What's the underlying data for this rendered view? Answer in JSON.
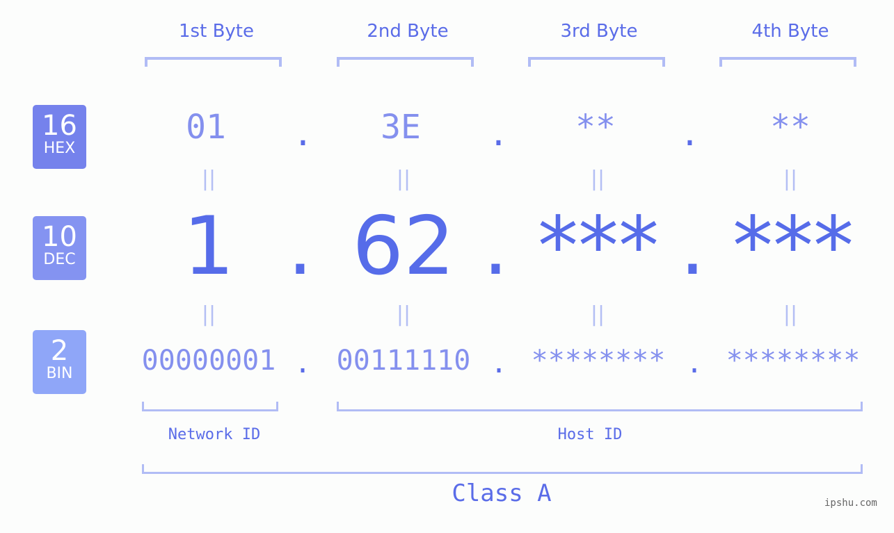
{
  "byte_headers": [
    "1st Byte",
    "2nd Byte",
    "3rd Byte",
    "4th Byte"
  ],
  "badges": [
    {
      "number": "16",
      "label": "HEX",
      "color": "#7582ec"
    },
    {
      "number": "10",
      "label": "DEC",
      "color": "#8493f1"
    },
    {
      "number": "2",
      "label": "BIN",
      "color": "#8fa6f8"
    }
  ],
  "hex": {
    "octets": [
      "01",
      "3E",
      "**",
      "**"
    ],
    "separator": "."
  },
  "dec": {
    "octets": [
      "1",
      "62",
      "***",
      "***"
    ],
    "separator": "."
  },
  "bin": {
    "octets": [
      "00000001",
      "00111110",
      "********",
      "********"
    ],
    "separator": "."
  },
  "equals_symbol": "||",
  "network_id_label": "Network ID",
  "host_id_label": "Host ID",
  "class_label": "Class A",
  "watermark": "ipshu.com",
  "colors": {
    "accent": "#566ce9",
    "light": "#8490ee",
    "bracket": "#b1bcf5"
  }
}
